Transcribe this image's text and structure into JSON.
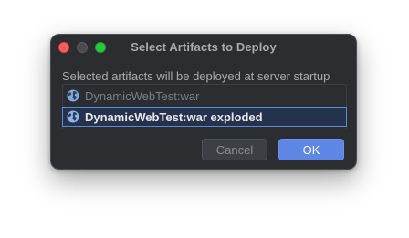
{
  "window": {
    "title": "Select Artifacts to Deploy"
  },
  "description": "Selected artifacts will be deployed at server startup",
  "artifacts": [
    {
      "label": "DynamicWebTest:war",
      "selected": false,
      "icon": "globe-icon"
    },
    {
      "label": "DynamicWebTest:war exploded",
      "selected": true,
      "icon": "globe-icon"
    }
  ],
  "buttons": {
    "cancel_label": "Cancel",
    "ok_label": "OK"
  },
  "colors": {
    "dialog_bg": "#2b2d30",
    "accent": "#5e86e5",
    "selection_bg": "#25324d",
    "selection_border": "#5b8bd6"
  }
}
